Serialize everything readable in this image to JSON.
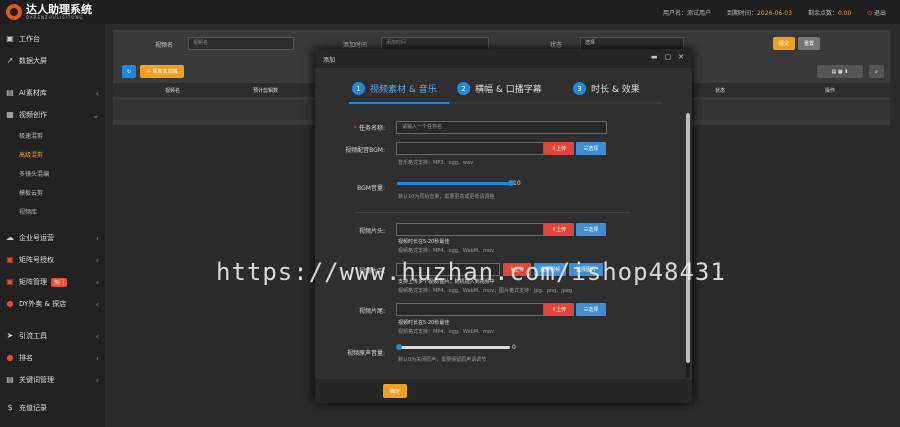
{
  "app": {
    "title": "达人助理系统",
    "subtitle": "DARENZHULISITONG"
  },
  "topbar": {
    "user_label": "用户名：",
    "user": "测试用户",
    "expire_label": "到期时间：",
    "expire": "2026-06-03",
    "points_label": "剩余点数：",
    "points": "0.00",
    "logout": "退出"
  },
  "sidebar": {
    "items": [
      {
        "label": "工作台",
        "icon": "desktop-icon"
      },
      {
        "label": "数据大屏",
        "icon": "chart-icon"
      },
      {
        "label": "AI素材库",
        "icon": "folder-icon"
      },
      {
        "label": "视频创作",
        "icon": "video-icon"
      }
    ],
    "sub": [
      "极速混剪",
      "高级混剪",
      "多镜头混编",
      "模板云剪",
      "视频库"
    ],
    "more": [
      {
        "label": "企业号运营",
        "icon": "cloud-icon"
      },
      {
        "label": "矩阵号授权",
        "icon": "grid-icon"
      },
      {
        "label": "矩阵管理",
        "icon": "manage-icon",
        "badge": "热门"
      },
      {
        "label": "DY外卖 & 探店",
        "icon": "store-icon"
      },
      {
        "label": "引流工具",
        "icon": "send-icon"
      },
      {
        "label": "排名",
        "icon": "rank-icon"
      },
      {
        "label": "关键词管理",
        "icon": "key-icon"
      },
      {
        "label": "充值记录",
        "icon": "money-icon"
      }
    ]
  },
  "filter": {
    "name_label": "视频名",
    "name_ph": "视频名",
    "time_label": "添加时间",
    "time_ph": "添加时间",
    "status_label": "状态",
    "status_val": "选择",
    "submit": "提交",
    "reset": "重置",
    "add": "+ 添加云剪辑"
  },
  "table": {
    "cols": [
      "视频名",
      "预计剪辑数",
      "状态",
      "操作"
    ]
  },
  "modal": {
    "title": "添加",
    "tabs": [
      {
        "n": "1",
        "label": "视频素材 & 音乐"
      },
      {
        "n": "2",
        "label": "横幅 & 口播字幕"
      },
      {
        "n": "3",
        "label": "时长 & 效果"
      }
    ],
    "task_label": "任务名称:",
    "task_ph": "请输入一个任务名",
    "bgm_label": "视频配音BGM:",
    "upload": "上传",
    "select": "选择",
    "bgm_help": "音乐格式支持：MP3、ogg、wav",
    "vol_label": "BGM音量:",
    "vol_val": "10",
    "vol_help": "默认10为原始音量，需要更高或更低请调整",
    "head_label": "视频片头:",
    "head_help1": "视频时长在5-20秒最佳",
    "head_help2": "视频格式支持：MP4、ogg、WebM、mov",
    "mid_label": "视频片中:",
    "mid_help1": "支持上传多个视频/图片，随机插入到视频中",
    "mid_help2": "视频格式支持：MP4、ogg、WebM、mov；图片格式支持：jpg、png、jpeg",
    "select_video": "选择视频",
    "select_image": "选择图片",
    "tail_label": "视频片尾:",
    "tail_help1": "视频时长在5-20秒最佳",
    "tail_help2": "视频格式支持：MP4、ogg、WebM、mov",
    "orig_label": "视频原声音量:",
    "orig_val": "0",
    "orig_help": "默认0为关闭原声，需要保留原声请调节",
    "confirm": "确定",
    "vol_level": 1.0,
    "orig_level": 0.0
  },
  "watermark": "https://www.huzhan.com/ishop48431"
}
